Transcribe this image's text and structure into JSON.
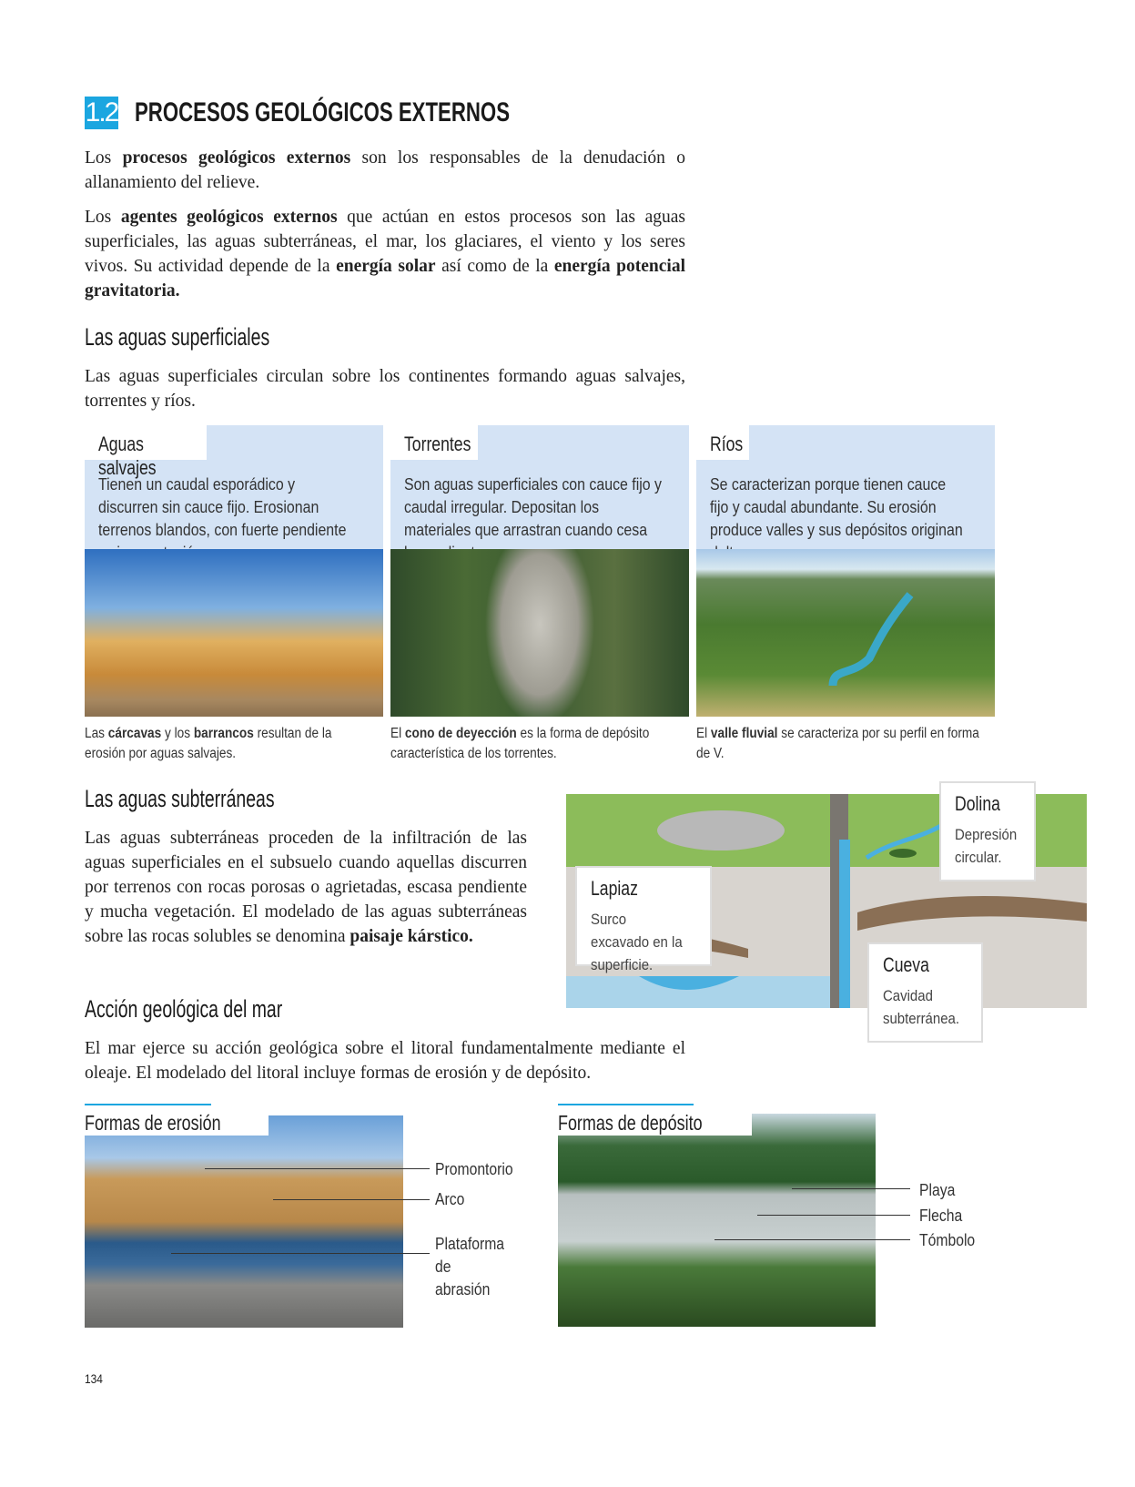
{
  "section": {
    "number": "1.2",
    "title": "PROCESOS GEOLÓGICOS EXTERNOS"
  },
  "intro": {
    "p1": [
      "Los ",
      "procesos geológicos externos",
      " son los responsables de la denudación o allanamiento del relieve."
    ],
    "p2": [
      "Los ",
      "agentes geológicos externos",
      " que actúan en estos procesos son las aguas superficiales, las aguas subterráneas, el mar, los glaciares, el viento y los seres vivos. Su actividad depende de la ",
      "energía solar",
      " así como de la ",
      "energía poten­cial gravitatoria."
    ]
  },
  "superficiales": {
    "heading": "Las aguas superficiales",
    "text": "Las aguas superficiales circulan sobre los continentes formando aguas salvajes, torrentes y ríos.",
    "boxes": [
      {
        "title": "Aguas salvajes",
        "text": "Tienen un caudal esporádico y discurren sin cauce fijo. Erosionan terrenos blandos, con fuerte pendiente y sin vegetación.",
        "caption": [
          "Las ",
          "cárcavas",
          " y los ",
          "barrancos",
          " resultan de la erosión por aguas salvajes."
        ]
      },
      {
        "title": "Torrentes",
        "text": "Son aguas superficiales con cauce fijo y caudal irregular. Depositan los materiales que arrastran cuando cesa la pendiente.",
        "caption": [
          "El ",
          "cono de deyección",
          " es la forma de depósito característica de los torrentes."
        ]
      },
      {
        "title": "Ríos",
        "text": "Se caracterizan porque tienen cauce fijo y caudal abundante. Su erosión produce valles y sus depósitos originan deltas.",
        "caption": [
          "El ",
          "valle fluvial",
          " se caracteriza por su perfil en forma de V."
        ]
      }
    ]
  },
  "subterraneas": {
    "heading": "Las aguas subterráneas",
    "text": [
      "Las aguas subterráneas proceden de la infiltración de las aguas superficiales en el subsuelo cuando aquellas discu­rren por terrenos con rocas porosas o agrietadas, escasa pendiente y mucha vegetación. El modelado de las aguas subterráneas sobre las rocas solubles se denomina ",
      "paisaje kárstico."
    ],
    "callouts": {
      "lapiaz": {
        "title": "Lapiaz",
        "desc": "Surco excavado en la superficie."
      },
      "dolina": {
        "title": "Dolina",
        "desc": "Depresión circular."
      },
      "cueva": {
        "title": "Cueva",
        "desc": "Cavidad subterránea."
      }
    }
  },
  "mar": {
    "heading": "Acción geológica del mar",
    "text": "El mar ejerce su acción geológica sobre el litoral fundamentalmente mediante el oleaje. El modelado del litoral incluye formas de erosión y de depósito.",
    "erosion": {
      "title": "Formas de erosión",
      "labels": [
        "Promontorio",
        "Arco",
        "Plataforma de abrasión"
      ]
    },
    "deposito": {
      "title": "Formas de depósito",
      "labels": [
        "Playa",
        "Flecha",
        "Tómbolo"
      ]
    }
  },
  "page_number": "134",
  "colors": {
    "accent": "#1ba6e0",
    "box": "#d4e3f5"
  }
}
